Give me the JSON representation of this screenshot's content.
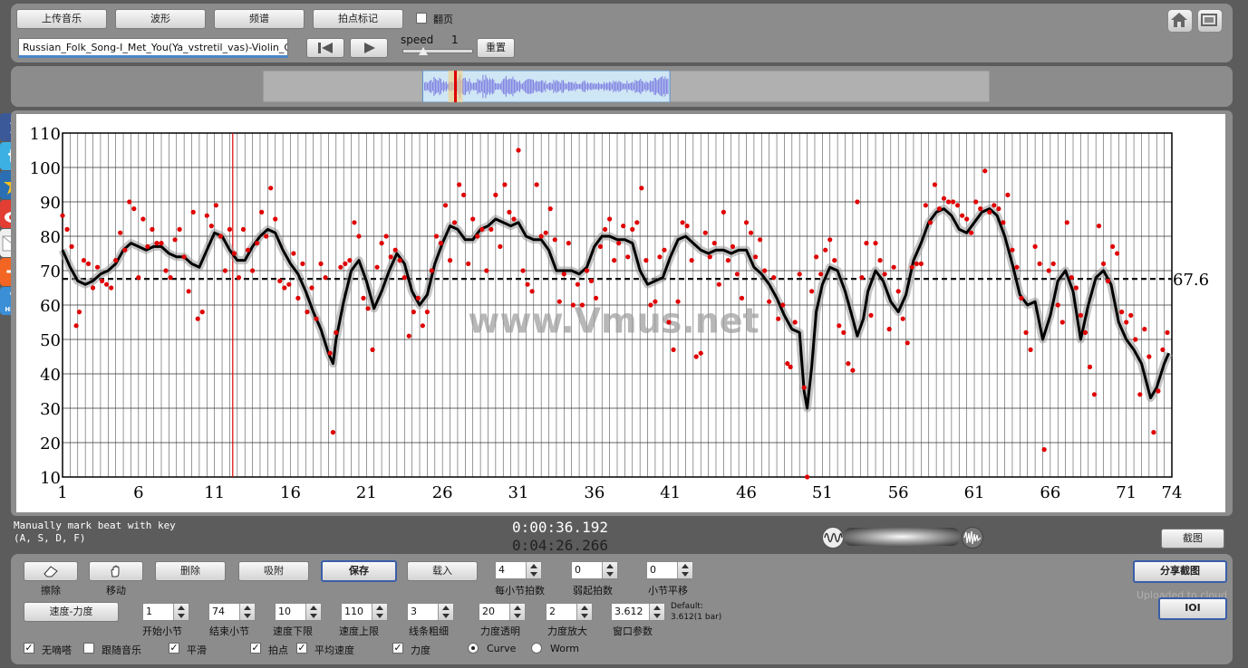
{
  "toolbar": {
    "upload_label": "上传音乐",
    "waveform_label": "波形",
    "spectrum_label": "频谱",
    "beatmark_label": "拍点标记",
    "pageturn_label": "翻页",
    "filename": "Russian_Folk_Song-I_Met_You(Ya_vstretil_vas)-Violin_Guit",
    "speed_label": "speed",
    "speed_value": "1",
    "reset_label": "重置"
  },
  "social": {
    "facebook": "f",
    "plus": "+",
    "help": "HELP"
  },
  "status": {
    "hint_line1": "Manually mark beat with key",
    "hint_line2": "(A, S, D, F)",
    "time_current": "0:00:36.192",
    "time_total": "0:04:26.266",
    "screenshot_label": "截图"
  },
  "controls": {
    "erase_label": "擦除",
    "move_label": "移动",
    "delete_label": "删除",
    "snap_label": "吸附",
    "save_label": "保存",
    "load_label": "载入",
    "beats_per_bar": {
      "value": "4",
      "label": "每小节拍数"
    },
    "pickup_beats": {
      "value": "0",
      "label": "弱起拍数"
    },
    "bar_shift": {
      "value": "0",
      "label": "小节平移"
    },
    "mode_label": "速度-力度",
    "start_bar": {
      "value": "1",
      "label": "开始小节"
    },
    "end_bar": {
      "value": "74",
      "label": "结束小节"
    },
    "tempo_min": {
      "value": "10",
      "label": "速度下限"
    },
    "tempo_max": {
      "value": "110",
      "label": "速度上限"
    },
    "line_width": {
      "value": "3",
      "label": "线条粗细"
    },
    "dyn_transparency": {
      "value": "20",
      "label": "力度透明"
    },
    "dyn_scale": {
      "value": "2",
      "label": "力度放大"
    },
    "window_param": {
      "value": "3.612",
      "label": "窗口参数"
    },
    "default_line1": "Default:",
    "default_line2": "3.612(1 bar)",
    "share_label": "分享截图",
    "uploaded_label": "Uploaded to cloud",
    "ioi_label": "IOI",
    "checks": [
      {
        "label": "无嘀嗒",
        "checked": true
      },
      {
        "label": "跟随音乐",
        "checked": false
      },
      {
        "label": "平滑",
        "checked": true
      },
      {
        "label": "拍点",
        "checked": true
      },
      {
        "label": "平均速度",
        "checked": true
      },
      {
        "label": "力度",
        "checked": true
      }
    ],
    "radio_curve": "Curve",
    "radio_worm": "Worm",
    "check_mark": "✓"
  },
  "chart_data": {
    "type": "scatter",
    "title": "",
    "xlabel": "",
    "ylabel": "",
    "watermark": "www.Vmus.net",
    "xlim": [
      1,
      74
    ],
    "ylim": [
      10,
      110
    ],
    "x_ticks": [
      "1",
      "6",
      "11",
      "16",
      "21",
      "26",
      "31",
      "36",
      "41",
      "46",
      "51",
      "56",
      "61",
      "66",
      "71",
      "74"
    ],
    "y_ticks": [
      "10",
      "20",
      "30",
      "40",
      "50",
      "60",
      "70",
      "80",
      "90",
      "100",
      "110"
    ],
    "average_tempo": 67.6,
    "average_label": "67.6",
    "cursor_bar": 12.2,
    "beats_per_bar": 4,
    "smooth_curve": [
      [
        1,
        76
      ],
      [
        1.5,
        71
      ],
      [
        2,
        67
      ],
      [
        2.5,
        66
      ],
      [
        3,
        67
      ],
      [
        3.5,
        69
      ],
      [
        4,
        70
      ],
      [
        4.5,
        72
      ],
      [
        5,
        76
      ],
      [
        5.5,
        78
      ],
      [
        6,
        77
      ],
      [
        6.5,
        76
      ],
      [
        7,
        77
      ],
      [
        7.5,
        77
      ],
      [
        8,
        75
      ],
      [
        8.5,
        74
      ],
      [
        9,
        74
      ],
      [
        9.5,
        72
      ],
      [
        10,
        71
      ],
      [
        10.5,
        76
      ],
      [
        11,
        81
      ],
      [
        11.5,
        80
      ],
      [
        12,
        76
      ],
      [
        12.5,
        73
      ],
      [
        13,
        73
      ],
      [
        13.5,
        77
      ],
      [
        14,
        80
      ],
      [
        14.5,
        82
      ],
      [
        15,
        81
      ],
      [
        15.5,
        76
      ],
      [
        16,
        72
      ],
      [
        16.5,
        69
      ],
      [
        17,
        64
      ],
      [
        17.5,
        58
      ],
      [
        18,
        53
      ],
      [
        18.5,
        46
      ],
      [
        18.8,
        43
      ],
      [
        19,
        50
      ],
      [
        19.5,
        61
      ],
      [
        20,
        70
      ],
      [
        20.5,
        73
      ],
      [
        21,
        67
      ],
      [
        21.5,
        59
      ],
      [
        22,
        64
      ],
      [
        22.5,
        70
      ],
      [
        23,
        75
      ],
      [
        23.5,
        72
      ],
      [
        24,
        64
      ],
      [
        24.5,
        60
      ],
      [
        25,
        63
      ],
      [
        25.5,
        72
      ],
      [
        26,
        78
      ],
      [
        26.5,
        83
      ],
      [
        27,
        82
      ],
      [
        27.5,
        79
      ],
      [
        28,
        79
      ],
      [
        28.5,
        82
      ],
      [
        29,
        83
      ],
      [
        29.5,
        85
      ],
      [
        30,
        84
      ],
      [
        30.5,
        83
      ],
      [
        31,
        84
      ],
      [
        31.5,
        80
      ],
      [
        32,
        79
      ],
      [
        32.5,
        79
      ],
      [
        33,
        76
      ],
      [
        33.5,
        70
      ],
      [
        34,
        70
      ],
      [
        34.5,
        70
      ],
      [
        35,
        69
      ],
      [
        35.5,
        71
      ],
      [
        36,
        77
      ],
      [
        36.5,
        80
      ],
      [
        37,
        80
      ],
      [
        37.5,
        79
      ],
      [
        38,
        79
      ],
      [
        38.5,
        78
      ],
      [
        39,
        70
      ],
      [
        39.5,
        66
      ],
      [
        40,
        67
      ],
      [
        40.5,
        68
      ],
      [
        41,
        74
      ],
      [
        41.5,
        79
      ],
      [
        42,
        80
      ],
      [
        42.5,
        78
      ],
      [
        43,
        76
      ],
      [
        43.5,
        75
      ],
      [
        44,
        76
      ],
      [
        44.5,
        76
      ],
      [
        45,
        75
      ],
      [
        45.5,
        76
      ],
      [
        46,
        76
      ],
      [
        46.5,
        71
      ],
      [
        47,
        69
      ],
      [
        47.5,
        66
      ],
      [
        48,
        62
      ],
      [
        48.5,
        57
      ],
      [
        49,
        53
      ],
      [
        49.5,
        52
      ],
      [
        49.8,
        35
      ],
      [
        50,
        30
      ],
      [
        50.3,
        42
      ],
      [
        50.6,
        58
      ],
      [
        51,
        66
      ],
      [
        51.5,
        71
      ],
      [
        52,
        70
      ],
      [
        52.5,
        64
      ],
      [
        53,
        56
      ],
      [
        53.3,
        51
      ],
      [
        53.7,
        56
      ],
      [
        54,
        64
      ],
      [
        54.5,
        70
      ],
      [
        55,
        67
      ],
      [
        55.5,
        61
      ],
      [
        56,
        58
      ],
      [
        56.5,
        63
      ],
      [
        57,
        73
      ],
      [
        57.5,
        78
      ],
      [
        58,
        84
      ],
      [
        58.5,
        87
      ],
      [
        59,
        88
      ],
      [
        59.5,
        86
      ],
      [
        60,
        82
      ],
      [
        60.5,
        81
      ],
      [
        61,
        84
      ],
      [
        61.5,
        87
      ],
      [
        62,
        88
      ],
      [
        62.5,
        86
      ],
      [
        63,
        80
      ],
      [
        63.5,
        72
      ],
      [
        64,
        63
      ],
      [
        64.5,
        60
      ],
      [
        65,
        61
      ],
      [
        65.5,
        50
      ],
      [
        66,
        57
      ],
      [
        66.5,
        67
      ],
      [
        67,
        70
      ],
      [
        67.5,
        64
      ],
      [
        68,
        50
      ],
      [
        68.5,
        60
      ],
      [
        69,
        68
      ],
      [
        69.5,
        70
      ],
      [
        70,
        66
      ],
      [
        70.5,
        55
      ],
      [
        71,
        50
      ],
      [
        71.5,
        47
      ],
      [
        72,
        43
      ],
      [
        72.3,
        38
      ],
      [
        72.6,
        33
      ],
      [
        73,
        36
      ],
      [
        73.5,
        43
      ],
      [
        73.8,
        46
      ]
    ],
    "beat_points": [
      [
        1,
        86
      ],
      [
        1.3,
        82
      ],
      [
        1.6,
        77
      ],
      [
        1.9,
        54
      ],
      [
        2.1,
        58
      ],
      [
        2.4,
        73
      ],
      [
        2.7,
        72
      ],
      [
        3,
        65
      ],
      [
        3.3,
        71
      ],
      [
        3.6,
        67
      ],
      [
        3.9,
        66
      ],
      [
        4.2,
        65
      ],
      [
        4.5,
        73
      ],
      [
        4.8,
        81
      ],
      [
        5.1,
        76
      ],
      [
        5.4,
        90
      ],
      [
        5.7,
        88
      ],
      [
        6,
        68
      ],
      [
        6.3,
        85
      ],
      [
        6.6,
        77
      ],
      [
        6.9,
        82
      ],
      [
        7.2,
        78
      ],
      [
        7.5,
        78
      ],
      [
        7.8,
        70
      ],
      [
        8.1,
        68
      ],
      [
        8.4,
        79
      ],
      [
        8.7,
        82
      ],
      [
        9,
        74
      ],
      [
        9.3,
        64
      ],
      [
        9.6,
        87
      ],
      [
        9.9,
        56
      ],
      [
        10.2,
        58
      ],
      [
        10.5,
        86
      ],
      [
        10.8,
        83
      ],
      [
        11.1,
        89
      ],
      [
        11.4,
        80
      ],
      [
        11.7,
        70
      ],
      [
        12,
        82
      ],
      [
        12.3,
        75
      ],
      [
        12.6,
        68
      ],
      [
        12.9,
        82
      ],
      [
        13.2,
        76
      ],
      [
        13.5,
        70
      ],
      [
        13.8,
        78
      ],
      [
        14.1,
        87
      ],
      [
        14.4,
        80
      ],
      [
        14.7,
        94
      ],
      [
        15,
        85
      ],
      [
        15.3,
        67
      ],
      [
        15.6,
        65
      ],
      [
        15.9,
        66
      ],
      [
        16.2,
        75
      ],
      [
        16.5,
        62
      ],
      [
        16.8,
        72
      ],
      [
        17.1,
        58
      ],
      [
        17.4,
        65
      ],
      [
        17.7,
        56
      ],
      [
        18,
        72
      ],
      [
        18.3,
        68
      ],
      [
        18.6,
        46
      ],
      [
        18.8,
        23
      ],
      [
        19,
        52
      ],
      [
        19.3,
        71
      ],
      [
        19.6,
        72
      ],
      [
        19.9,
        73
      ],
      [
        20.2,
        84
      ],
      [
        20.5,
        80
      ],
      [
        20.8,
        62
      ],
      [
        21.1,
        59
      ],
      [
        21.4,
        47
      ],
      [
        21.7,
        71
      ],
      [
        22,
        78
      ],
      [
        22.3,
        80
      ],
      [
        22.6,
        74
      ],
      [
        22.9,
        76
      ],
      [
        23.2,
        73
      ],
      [
        23.5,
        68
      ],
      [
        23.8,
        51
      ],
      [
        24.1,
        58
      ],
      [
        24.4,
        62
      ],
      [
        24.7,
        54
      ],
      [
        25,
        58
      ],
      [
        25.3,
        70
      ],
      [
        25.6,
        80
      ],
      [
        25.9,
        78
      ],
      [
        26.2,
        89
      ],
      [
        26.5,
        73
      ],
      [
        26.8,
        84
      ],
      [
        27.1,
        95
      ],
      [
        27.4,
        92
      ],
      [
        27.7,
        72
      ],
      [
        28,
        85
      ],
      [
        28.3,
        80
      ],
      [
        28.6,
        82
      ],
      [
        28.9,
        70
      ],
      [
        29.2,
        82
      ],
      [
        29.5,
        92
      ],
      [
        29.8,
        77
      ],
      [
        30.1,
        95
      ],
      [
        30.4,
        87
      ],
      [
        30.7,
        85
      ],
      [
        31,
        105
      ],
      [
        31.3,
        70
      ],
      [
        31.6,
        66
      ],
      [
        31.9,
        64
      ],
      [
        32.2,
        95
      ],
      [
        32.5,
        80
      ],
      [
        32.8,
        81
      ],
      [
        33.1,
        88
      ],
      [
        33.4,
        79
      ],
      [
        33.7,
        61
      ],
      [
        34,
        69
      ],
      [
        34.3,
        78
      ],
      [
        34.6,
        60
      ],
      [
        34.9,
        66
      ],
      [
        35.2,
        60
      ],
      [
        35.5,
        70
      ],
      [
        35.8,
        67
      ],
      [
        36.1,
        62
      ],
      [
        36.4,
        77
      ],
      [
        36.7,
        82
      ],
      [
        37,
        85
      ],
      [
        37.3,
        73
      ],
      [
        37.6,
        78
      ],
      [
        37.9,
        83
      ],
      [
        38.2,
        74
      ],
      [
        38.5,
        82
      ],
      [
        38.8,
        84
      ],
      [
        39.1,
        94
      ],
      [
        39.4,
        73
      ],
      [
        39.7,
        60
      ],
      [
        40,
        61
      ],
      [
        40.3,
        74
      ],
      [
        40.6,
        76
      ],
      [
        40.9,
        55
      ],
      [
        41.2,
        47
      ],
      [
        41.5,
        61
      ],
      [
        41.8,
        84
      ],
      [
        42.1,
        83
      ],
      [
        42.4,
        73
      ],
      [
        42.7,
        45
      ],
      [
        43,
        46
      ],
      [
        43.3,
        81
      ],
      [
        43.6,
        74
      ],
      [
        43.9,
        78
      ],
      [
        44.2,
        66
      ],
      [
        44.5,
        87
      ],
      [
        44.8,
        73
      ],
      [
        45.1,
        77
      ],
      [
        45.4,
        69
      ],
      [
        45.7,
        62
      ],
      [
        46,
        84
      ],
      [
        46.3,
        81
      ],
      [
        46.6,
        74
      ],
      [
        46.9,
        79
      ],
      [
        47.2,
        70
      ],
      [
        47.5,
        61
      ],
      [
        47.8,
        68
      ],
      [
        48.1,
        56
      ],
      [
        48.4,
        60
      ],
      [
        48.7,
        43
      ],
      [
        48.9,
        42
      ],
      [
        49.2,
        55
      ],
      [
        49.5,
        69
      ],
      [
        49.8,
        36
      ],
      [
        50,
        10
      ],
      [
        50.3,
        64
      ],
      [
        50.6,
        74
      ],
      [
        50.9,
        69
      ],
      [
        51.2,
        76
      ],
      [
        51.5,
        79
      ],
      [
        51.8,
        73
      ],
      [
        52.1,
        54
      ],
      [
        52.4,
        52
      ],
      [
        52.7,
        43
      ],
      [
        53,
        41
      ],
      [
        53.3,
        90
      ],
      [
        53.6,
        68
      ],
      [
        53.9,
        78
      ],
      [
        54.2,
        57
      ],
      [
        54.5,
        78
      ],
      [
        54.8,
        73
      ],
      [
        55.1,
        69
      ],
      [
        55.4,
        53
      ],
      [
        55.7,
        71
      ],
      [
        56,
        64
      ],
      [
        56.3,
        56
      ],
      [
        56.6,
        49
      ],
      [
        56.9,
        71
      ],
      [
        57.2,
        72
      ],
      [
        57.5,
        72
      ],
      [
        57.8,
        89
      ],
      [
        58.1,
        84
      ],
      [
        58.4,
        95
      ],
      [
        58.7,
        88
      ],
      [
        59,
        91
      ],
      [
        59.3,
        90
      ],
      [
        59.6,
        90
      ],
      [
        59.9,
        89
      ],
      [
        60.2,
        86
      ],
      [
        60.5,
        85
      ],
      [
        60.8,
        81
      ],
      [
        61.1,
        90
      ],
      [
        61.4,
        88
      ],
      [
        61.7,
        99
      ],
      [
        62,
        87
      ],
      [
        62.3,
        89
      ],
      [
        62.6,
        88
      ],
      [
        62.9,
        84
      ],
      [
        63.2,
        92
      ],
      [
        63.5,
        76
      ],
      [
        63.8,
        71
      ],
      [
        64.1,
        62
      ],
      [
        64.4,
        52
      ],
      [
        64.7,
        47
      ],
      [
        65,
        77
      ],
      [
        65.3,
        72
      ],
      [
        65.6,
        18
      ],
      [
        65.9,
        70
      ],
      [
        66.2,
        72
      ],
      [
        66.5,
        60
      ],
      [
        66.8,
        55
      ],
      [
        67.1,
        84
      ],
      [
        67.4,
        68
      ],
      [
        67.7,
        65
      ],
      [
        68,
        57
      ],
      [
        68.3,
        52
      ],
      [
        68.6,
        42
      ],
      [
        68.9,
        34
      ],
      [
        69.2,
        83
      ],
      [
        69.5,
        72
      ],
      [
        69.8,
        67
      ],
      [
        70.1,
        77
      ],
      [
        70.4,
        75
      ],
      [
        70.7,
        58
      ],
      [
        71,
        55
      ],
      [
        71.3,
        57
      ],
      [
        71.6,
        50
      ],
      [
        71.9,
        34
      ],
      [
        72.2,
        53
      ],
      [
        72.5,
        45
      ],
      [
        72.8,
        23
      ],
      [
        73.1,
        35
      ],
      [
        73.4,
        47
      ],
      [
        73.7,
        52
      ]
    ],
    "overview_range": [
      0.22,
      0.56
    ],
    "overview_playhead": 0.265
  }
}
